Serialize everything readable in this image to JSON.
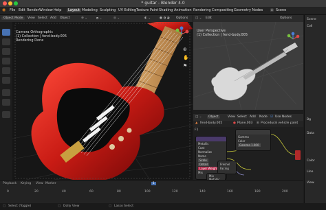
{
  "window": {
    "title": "* guitar - Blender 4.0"
  },
  "menu": {
    "items": [
      "File",
      "Edit",
      "Render",
      "Window",
      "Help"
    ],
    "workspaces": [
      "Layout",
      "Modeling",
      "Sculpting",
      "UV Editing",
      "Texture Paint",
      "Shading",
      "Animation",
      "Rendering",
      "Compositing",
      "Geometry Nodes"
    ],
    "active_workspace": "Layout",
    "scene_label": "Scene"
  },
  "viewport": {
    "mode": "Object Mode",
    "menus": [
      "View",
      "Select",
      "Add",
      "Object"
    ],
    "shading_label": "Options",
    "overlay_lines": [
      "Camera Orthographic",
      "(1) Collection | fend-body.005",
      "Rendering Done"
    ]
  },
  "right_viewport": {
    "menus": [
      "Edit"
    ],
    "options_label": "Options",
    "overlay_lines": [
      "User Perspective",
      "(1) Collection | fend-body.005"
    ]
  },
  "node_editor": {
    "header": {
      "object_label": "Object",
      "menus": [
        "View",
        "Select",
        "Add",
        "Node"
      ],
      "use_nodes_label": "Use Nodes"
    },
    "sub": {
      "object_name": "fend-body.005",
      "material_name": "Plane.003",
      "node_tree": "Procedural vehicle paint"
    },
    "slot_label": "F1",
    "nodes": {
      "left": {
        "rows": [
          "Metallic",
          "Coat",
          "Normalize",
          "Name",
          "Scale",
          "Detail",
          "Layer Weight",
          "Mix"
        ]
      },
      "right": {
        "rows": [
          "Gamma",
          "Color",
          "Gamma 1.000"
        ]
      },
      "small1": {
        "rows": [
          "Fresnel",
          "Facing"
        ]
      },
      "small2": {
        "rows": [
          "Mix",
          "Metallic"
        ]
      }
    }
  },
  "outliner": {
    "items": [
      "Scene",
      "Coll",
      "Bg",
      "Data",
      "Color",
      "Line",
      "View"
    ]
  },
  "timeline": {
    "labels": [
      "Playback",
      "Keying",
      "View",
      "Marker"
    ],
    "frame": "1",
    "ticks": [
      "0",
      "20",
      "40",
      "60",
      "80",
      "100",
      "120",
      "140",
      "160",
      "180",
      "200"
    ]
  },
  "status": {
    "items": [
      "Select (Toggle)",
      "Dolly View",
      "Lasso Select"
    ]
  }
}
